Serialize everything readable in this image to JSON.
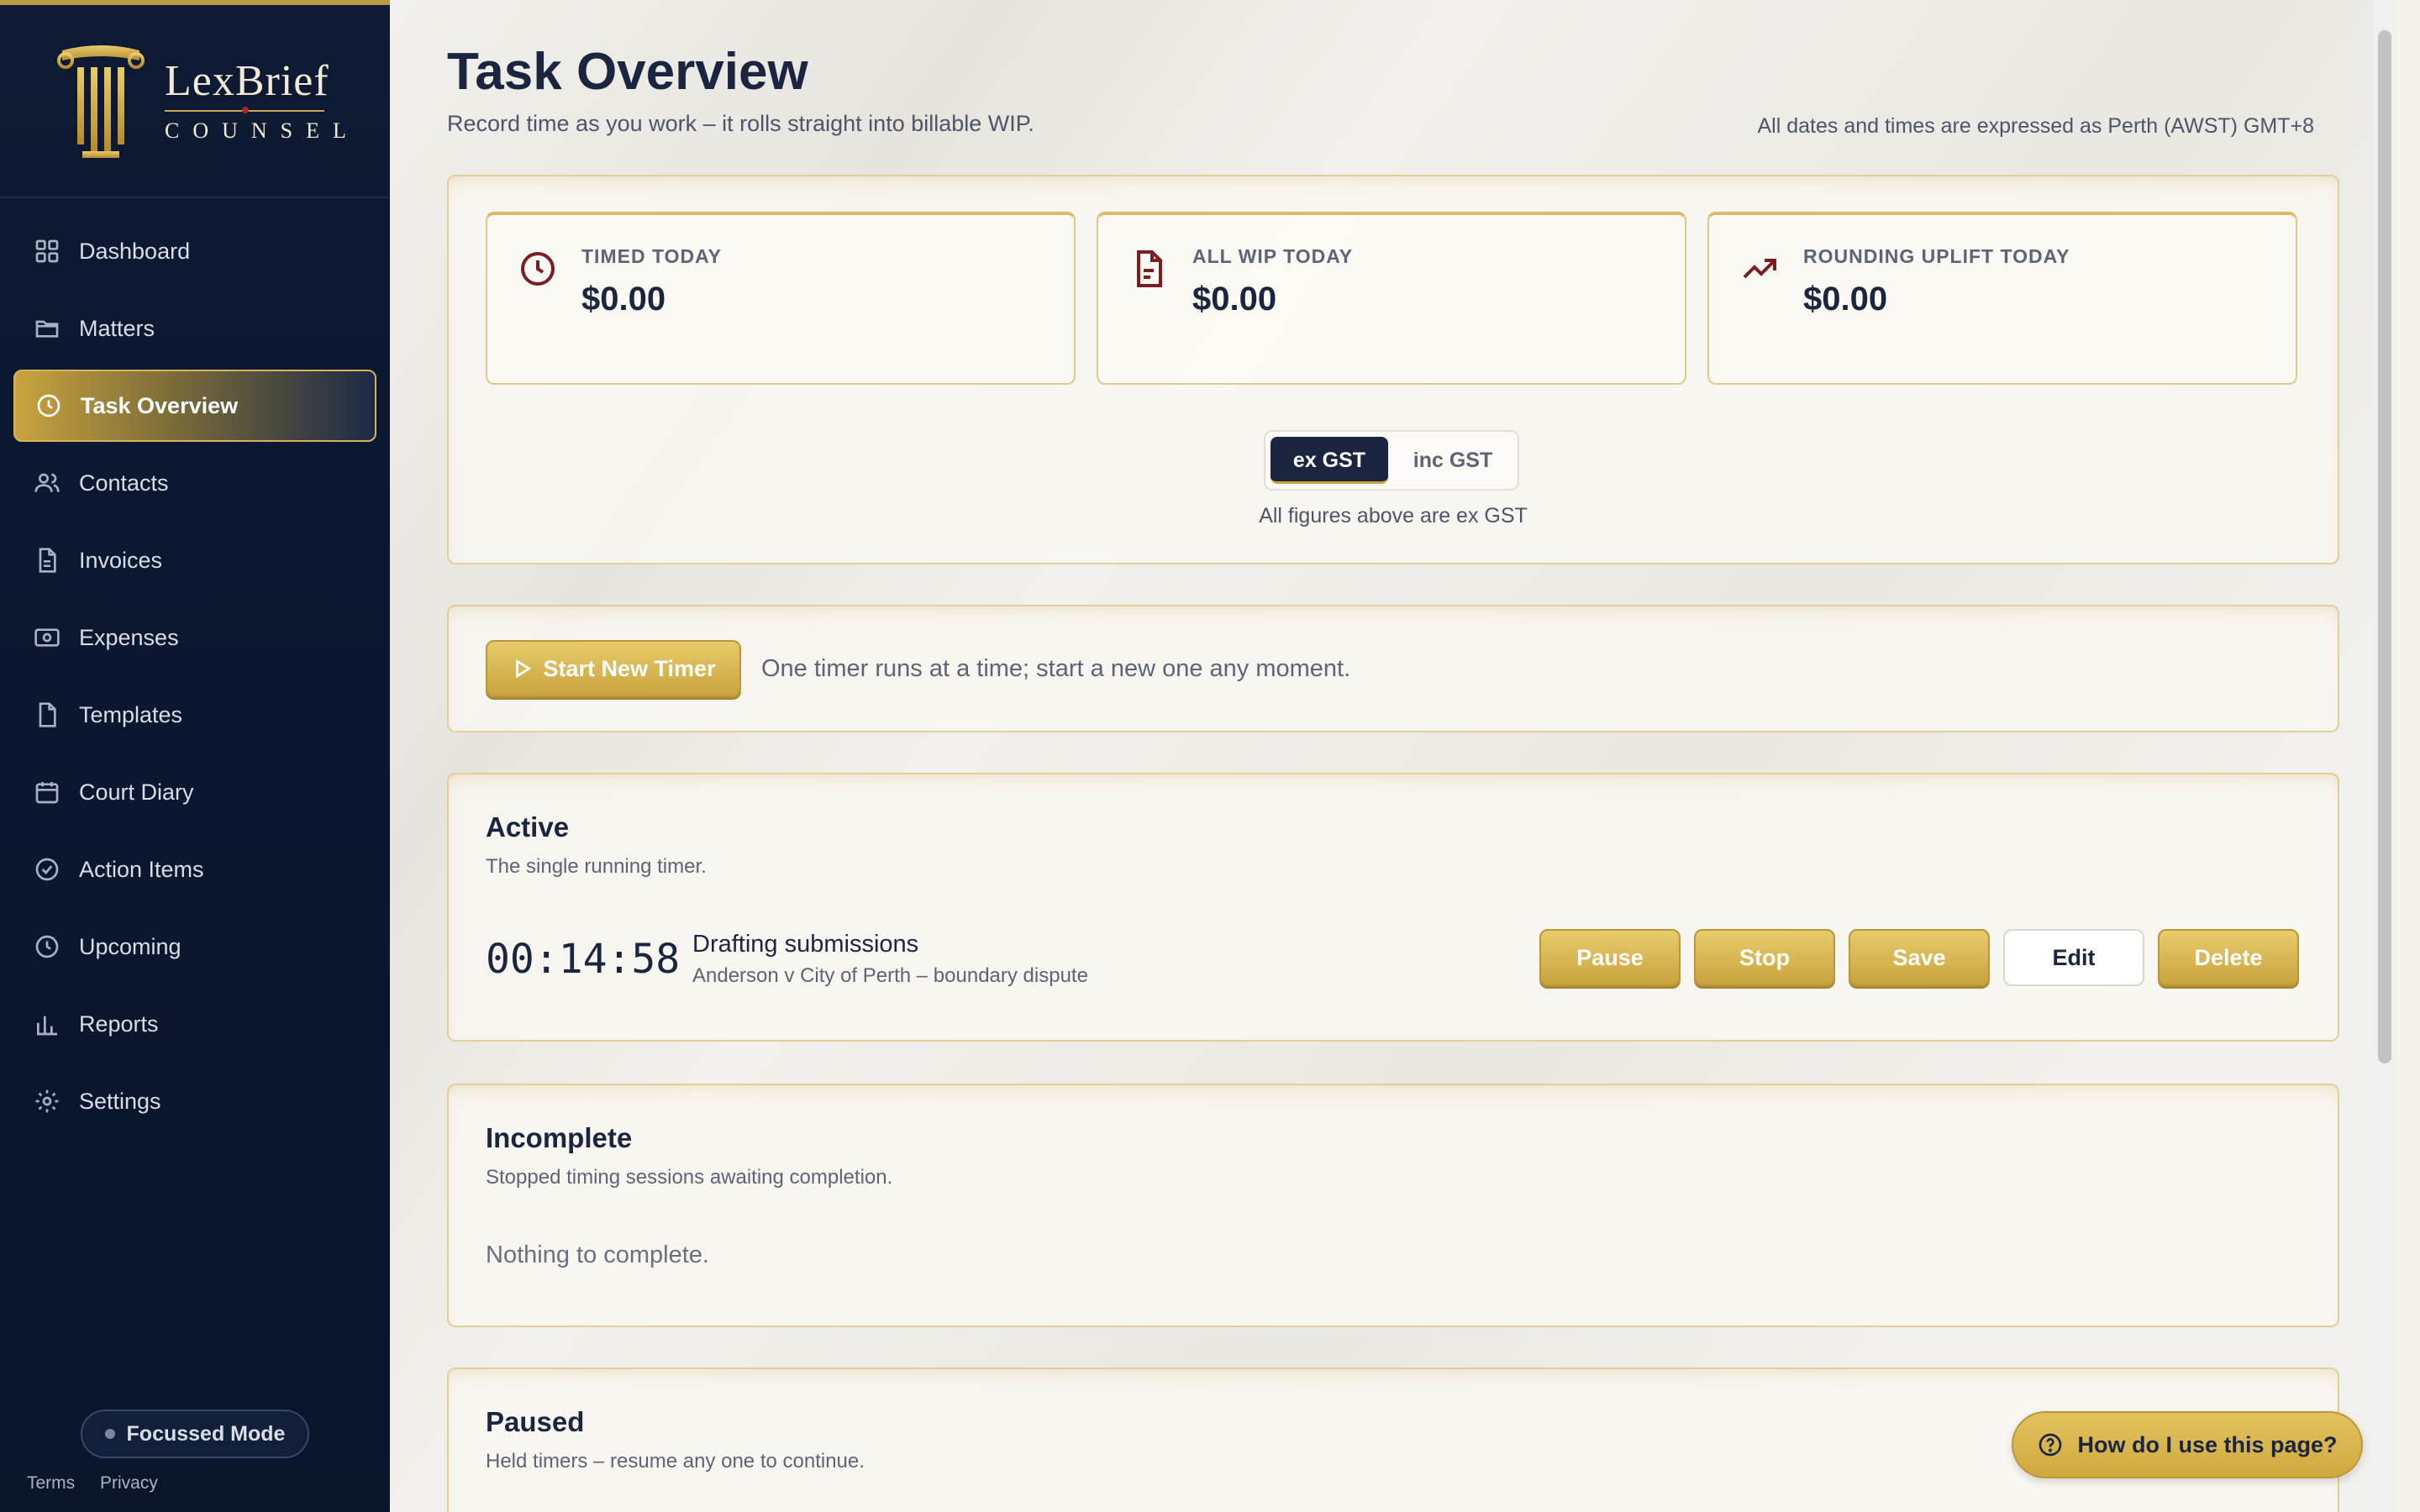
{
  "brand": {
    "name": "LexBrief",
    "subtitle": "COUNSEL"
  },
  "sidebar": {
    "items": [
      {
        "label": "Dashboard",
        "icon": "grid-icon",
        "active": false
      },
      {
        "label": "Matters",
        "icon": "folder-icon",
        "active": false
      },
      {
        "label": "Task Overview",
        "icon": "clock-icon",
        "active": true
      },
      {
        "label": "Contacts",
        "icon": "users-icon",
        "active": false
      },
      {
        "label": "Invoices",
        "icon": "file-icon",
        "active": false
      },
      {
        "label": "Expenses",
        "icon": "banknote-icon",
        "active": false
      },
      {
        "label": "Templates",
        "icon": "document-icon",
        "active": false
      },
      {
        "label": "Court Diary",
        "icon": "calendar-icon",
        "active": false
      },
      {
        "label": "Action Items",
        "icon": "check-circle-icon",
        "active": false
      },
      {
        "label": "Upcoming",
        "icon": "clock-icon",
        "active": false
      },
      {
        "label": "Reports",
        "icon": "bar-chart-icon",
        "active": false
      },
      {
        "label": "Settings",
        "icon": "gear-icon",
        "active": false
      }
    ],
    "focus_mode": "Focussed Mode",
    "terms": "Terms",
    "privacy": "Privacy"
  },
  "header": {
    "title": "Task Overview",
    "subtitle": "Record time as you work – it rolls straight into billable WIP.",
    "timezone_note": "All dates and times are expressed as Perth (AWST) GMT+8"
  },
  "stats": [
    {
      "label": "TIMED TODAY",
      "value": "$0.00",
      "icon": "clock-icon"
    },
    {
      "label": "ALL WIP TODAY",
      "value": "$0.00",
      "icon": "file-text-icon"
    },
    {
      "label": "ROUNDING UPLIFT TODAY",
      "value": "$0.00",
      "icon": "trending-up-icon"
    }
  ],
  "gst": {
    "options": [
      "ex GST",
      "inc GST"
    ],
    "selected": "ex GST",
    "note": "All figures above are ex GST"
  },
  "timer": {
    "start_label": "Start New Timer",
    "hint": "One timer runs at a time; start a new one any moment."
  },
  "active": {
    "title": "Active",
    "subtitle": "The single running timer.",
    "clock": "00:14:58",
    "task": "Drafting submissions",
    "matter": "Anderson v City of Perth – boundary dispute",
    "buttons": [
      "Pause",
      "Stop",
      "Save",
      "Edit",
      "Delete"
    ]
  },
  "incomplete": {
    "title": "Incomplete",
    "subtitle": "Stopped timing sessions awaiting completion.",
    "empty": "Nothing to complete."
  },
  "paused": {
    "title": "Paused",
    "subtitle": "Held timers – resume any one to continue."
  },
  "help": {
    "label": "How do I use this page?"
  },
  "colors": {
    "navy": "#0e1a33",
    "gold": "#c9a43e",
    "burgundy": "#7a1e25"
  }
}
